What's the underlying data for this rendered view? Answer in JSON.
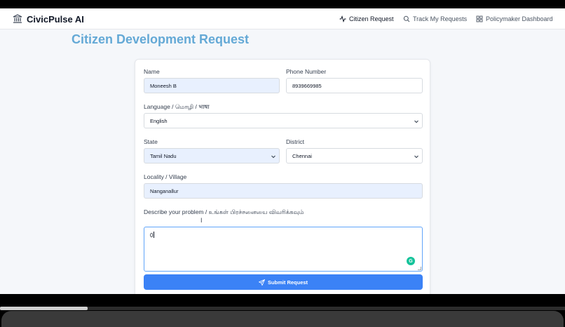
{
  "brand": {
    "name": "CivicPulse AI",
    "icon": "bank-icon"
  },
  "nav": [
    {
      "label": "Citizen Request",
      "icon": "activity-icon",
      "active": true
    },
    {
      "label": "Track My Requests",
      "icon": "search-icon",
      "active": false
    },
    {
      "label": "Policymaker Dashboard",
      "icon": "grid-icon",
      "active": false
    }
  ],
  "page": {
    "title": "Citizen Development Request"
  },
  "form": {
    "name": {
      "label": "Name",
      "value": "Moneesh B"
    },
    "phone": {
      "label": "Phone Number",
      "value": "8939669985"
    },
    "language": {
      "label": "Language / மொழி / भाषा",
      "value": "English"
    },
    "state": {
      "label": "State",
      "value": "Tamil Nadu"
    },
    "district": {
      "label": "District",
      "value": "Chennai"
    },
    "locality": {
      "label": "Locality / Village",
      "value": "Nanganallur"
    },
    "problem": {
      "label": "Describe your problem / உங்கள் பிரச்சனையை விவரிக்கவும்",
      "value": "0"
    },
    "submit_label": "Submit Request"
  },
  "colors": {
    "title": "#64a9d6",
    "primary": "#3b82f6",
    "filled_field": "#e8f0fe"
  }
}
